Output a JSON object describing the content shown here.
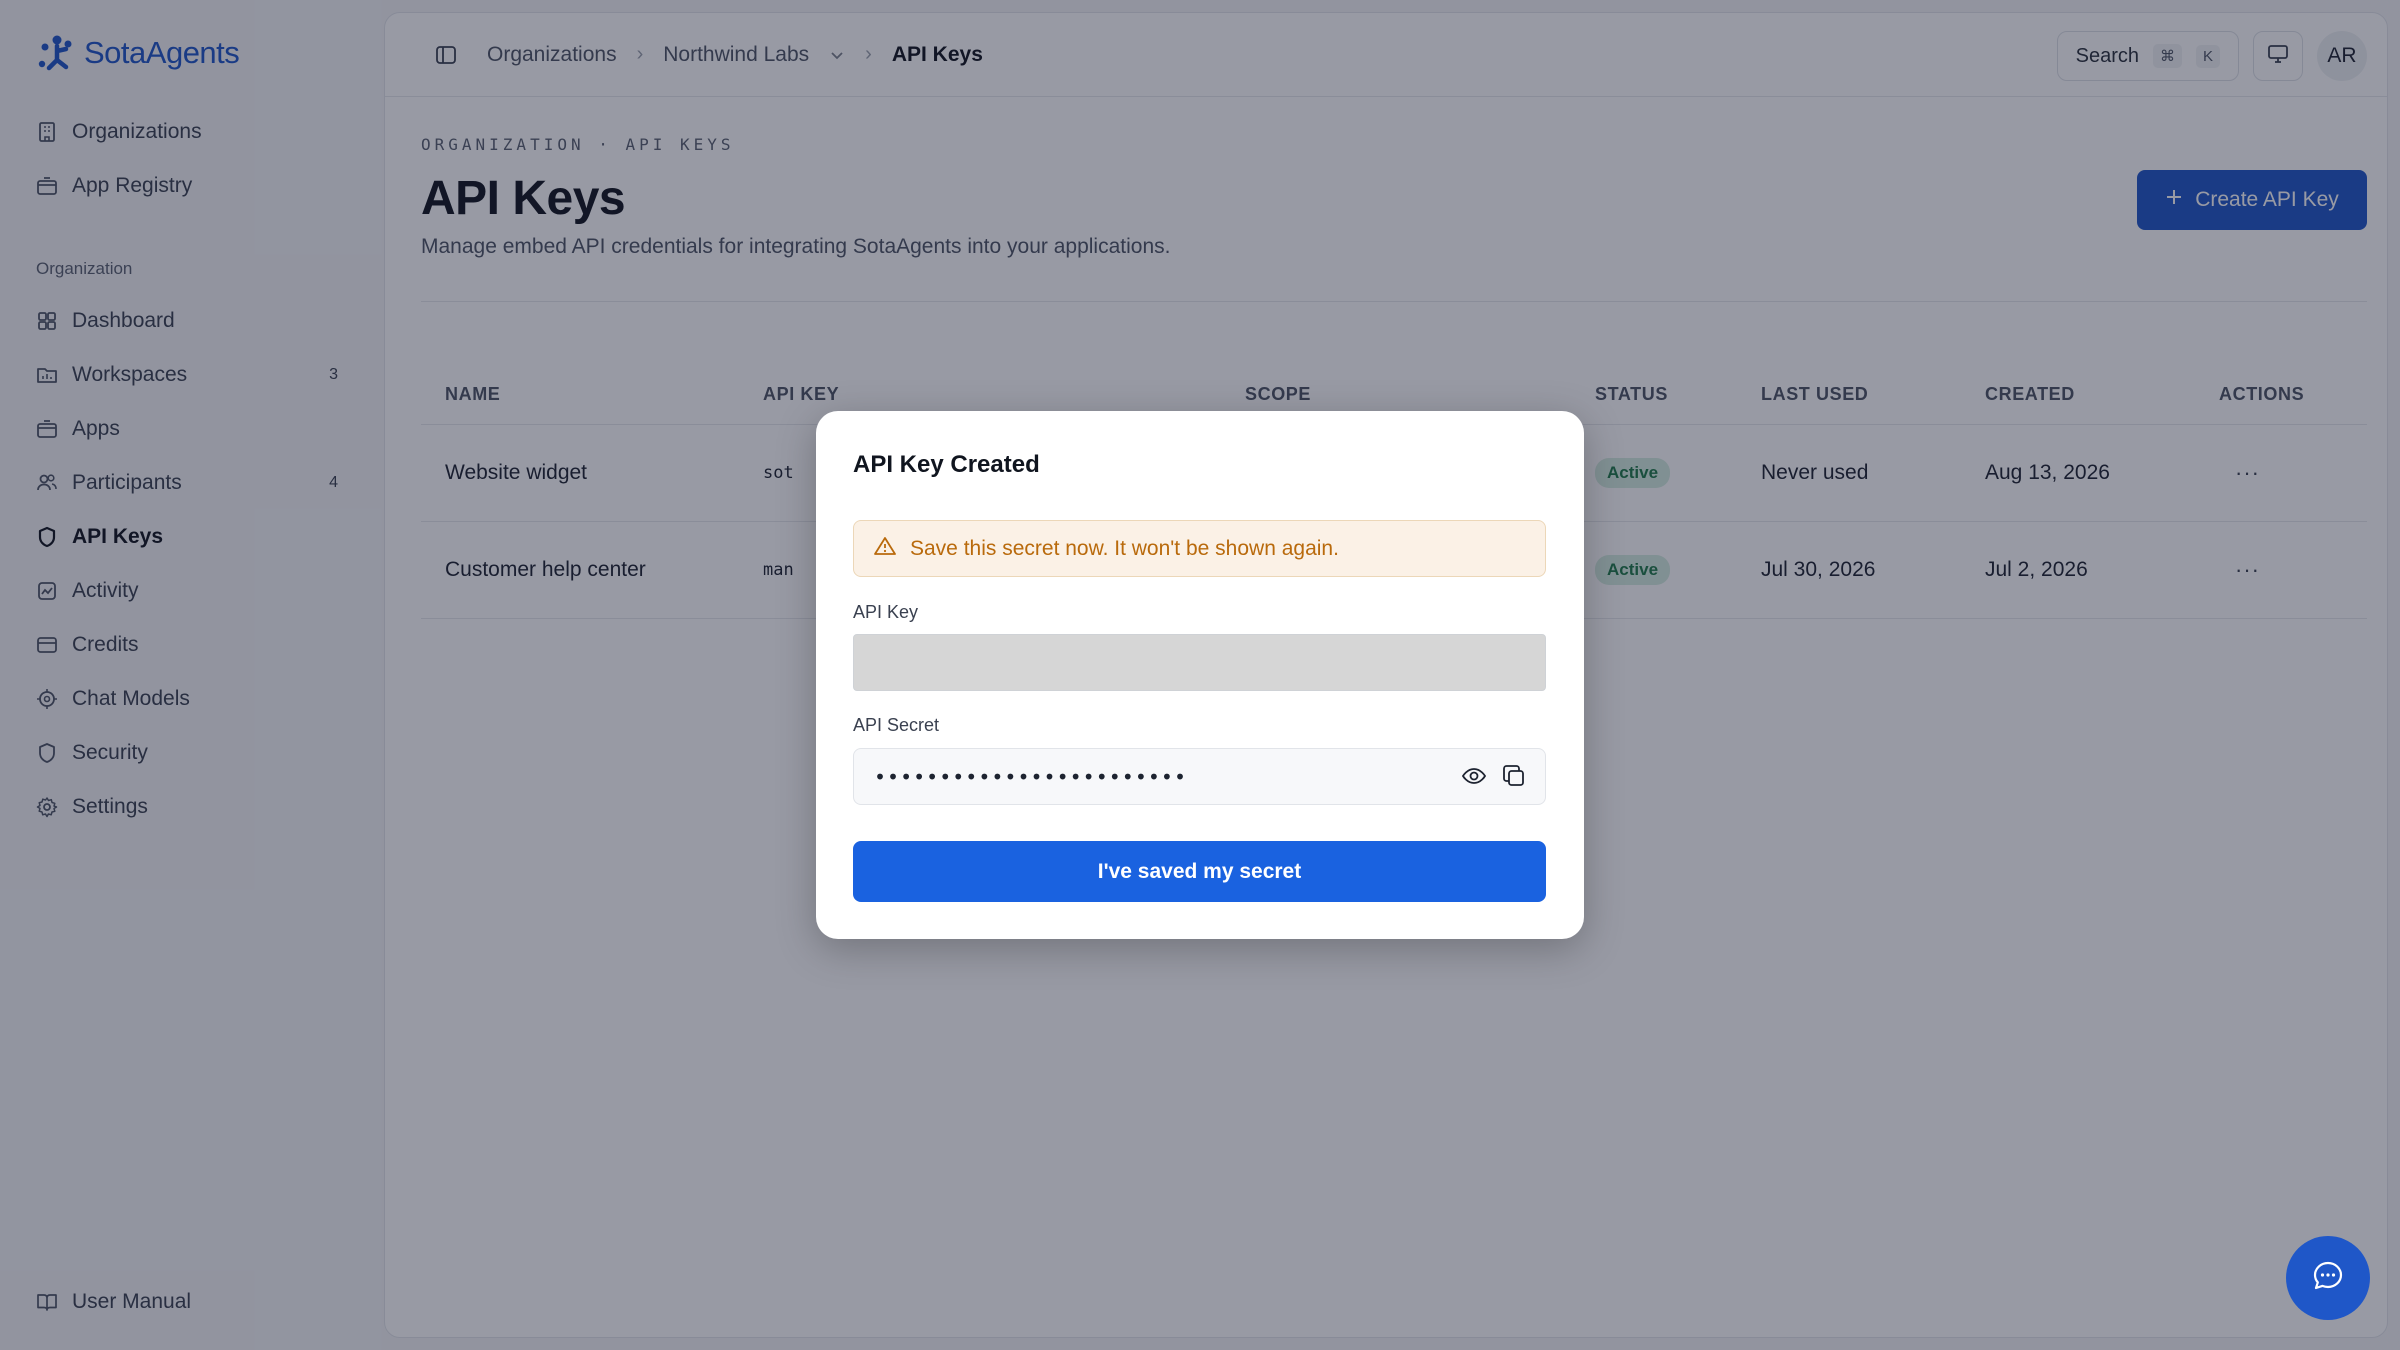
{
  "brand": {
    "name": "SotaAgents",
    "color": "#1f57c8"
  },
  "sidebar": {
    "top_items": [
      {
        "label": "Organizations",
        "icon": "building-icon"
      },
      {
        "label": "App Registry",
        "icon": "package-icon"
      }
    ],
    "section_label": "Organization",
    "items": [
      {
        "label": "Dashboard",
        "icon": "grid-icon",
        "badge": ""
      },
      {
        "label": "Workspaces",
        "icon": "folder-icon",
        "badge": "3"
      },
      {
        "label": "Apps",
        "icon": "box-icon",
        "badge": ""
      },
      {
        "label": "Participants",
        "icon": "users-icon",
        "badge": "4"
      },
      {
        "label": "API Keys",
        "icon": "shield-icon",
        "badge": "",
        "active": true
      },
      {
        "label": "Activity",
        "icon": "activity-icon",
        "badge": ""
      },
      {
        "label": "Credits",
        "icon": "card-icon",
        "badge": ""
      },
      {
        "label": "Chat Models",
        "icon": "cpu-icon",
        "badge": ""
      },
      {
        "label": "Security",
        "icon": "shield-icon",
        "badge": ""
      },
      {
        "label": "Settings",
        "icon": "gear-icon",
        "badge": ""
      }
    ],
    "footer_item": {
      "label": "User Manual",
      "icon": "book-icon"
    }
  },
  "topbar": {
    "breadcrumbs": [
      "Organizations",
      "Northwind Labs",
      "API Keys"
    ],
    "search_label": "Search",
    "search_kbd": [
      "⌘",
      "K"
    ],
    "avatar_initials": "AR"
  },
  "page": {
    "eyebrow": "ORGANIZATION · API KEYS",
    "title": "API Keys",
    "subtitle": "Manage embed API credentials for integrating SotaAgents into your applications.",
    "create_button": "Create API Key"
  },
  "table": {
    "columns": [
      "NAME",
      "API KEY",
      "SCOPE",
      "STATUS",
      "LAST USED",
      "CREATED",
      "ACTIONS"
    ],
    "rows": [
      {
        "name": "Website widget",
        "key": "sot",
        "scope": "",
        "status": "Active",
        "last_used": "Never used",
        "created": "Aug 13, 2026",
        "actions": "···"
      },
      {
        "name": "Customer help center",
        "key": "man",
        "scope": "",
        "status": "Active",
        "last_used": "Jul 30, 2026",
        "created": "Jul 2, 2026",
        "actions": "···"
      }
    ]
  },
  "modal": {
    "title": "API Key Created",
    "warning": "Save this secret now. It won't be shown again.",
    "key_label": "API Key",
    "key_value": "",
    "secret_label": "API Secret",
    "secret_masked": "••••••••••••••••••••••••",
    "confirm_button": "I've saved my secret"
  }
}
